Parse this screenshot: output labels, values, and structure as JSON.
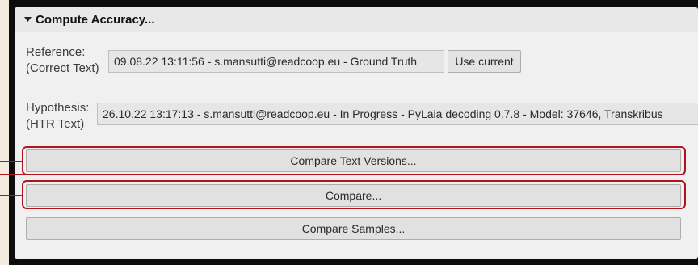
{
  "section": {
    "title": "Compute Accuracy..."
  },
  "reference": {
    "label_line1": "Reference:",
    "label_line2": "(Correct Text)",
    "value": "09.08.22 13:11:56 - s.mansutti@readcoop.eu - Ground Truth",
    "use_current_label": "Use current"
  },
  "hypothesis": {
    "label_line1": "Hypothesis:",
    "label_line2": "(HTR Text)",
    "value": "26.10.22 13:17:13 - s.mansutti@readcoop.eu - In Progress - PyLaia decoding 0.7.8 - Model: 37646, Transkribus"
  },
  "buttons": {
    "compare_text_versions": "Compare Text Versions...",
    "compare": "Compare...",
    "compare_samples": "Compare Samples..."
  },
  "colors": {
    "highlight": "#b0141e",
    "background": "#f4ebe0"
  }
}
